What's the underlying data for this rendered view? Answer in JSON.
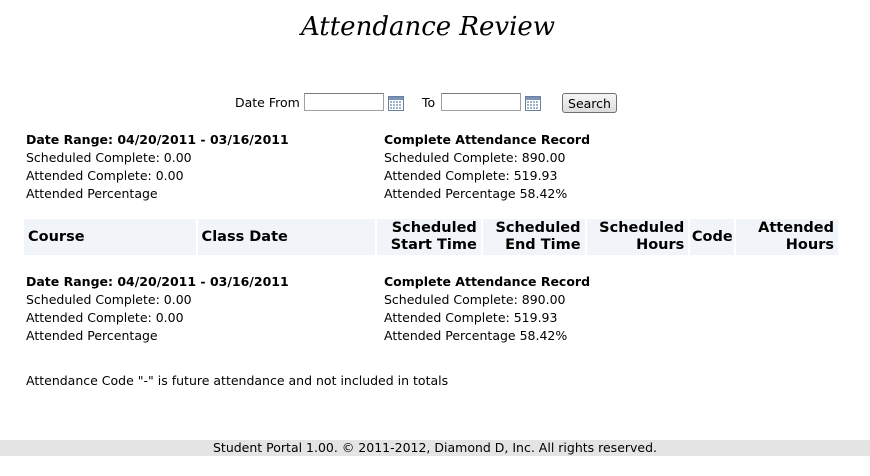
{
  "page": {
    "title": "Attendance Review"
  },
  "search": {
    "date_from_label": "Date From",
    "date_from_value": "",
    "to_label": "To",
    "to_value": "",
    "calendar_icon": "calendar-icon",
    "search_label": "Search"
  },
  "summaries": [
    {
      "range": {
        "heading": "Date Range: 04/20/2011 - 03/16/2011",
        "scheduled": "Scheduled Complete: 0.00",
        "attended": "Attended Complete: 0.00",
        "percentage": "Attended Percentage"
      },
      "record": {
        "heading": "Complete Attendance Record",
        "scheduled": "Scheduled Complete: 890.00",
        "attended": "Attended Complete: 519.93",
        "percentage": "Attended Percentage 58.42%"
      }
    },
    {
      "range": {
        "heading": "Date Range: 04/20/2011 - 03/16/2011",
        "scheduled": "Scheduled Complete: 0.00",
        "attended": "Attended Complete: 0.00",
        "percentage": "Attended Percentage"
      },
      "record": {
        "heading": "Complete Attendance Record",
        "scheduled": "Scheduled Complete: 890.00",
        "attended": "Attended Complete: 519.93",
        "percentage": "Attended Percentage 58.42%"
      }
    }
  ],
  "table": {
    "headers": {
      "course": "Course",
      "class_date": "Class Date",
      "sched_start_1": "Scheduled",
      "sched_start_2": "Start Time",
      "sched_end_1": "Scheduled",
      "sched_end_2": "End Time",
      "sched_hours_1": "Scheduled",
      "sched_hours_2": "Hours",
      "code": "Code",
      "att_hours_1": "Attended",
      "att_hours_2": "Hours"
    }
  },
  "note": "Attendance Code \"-\" is future attendance and not included in totals",
  "footer": "Student Portal 1.00. © 2011-2012, Diamond D, Inc. All rights reserved."
}
